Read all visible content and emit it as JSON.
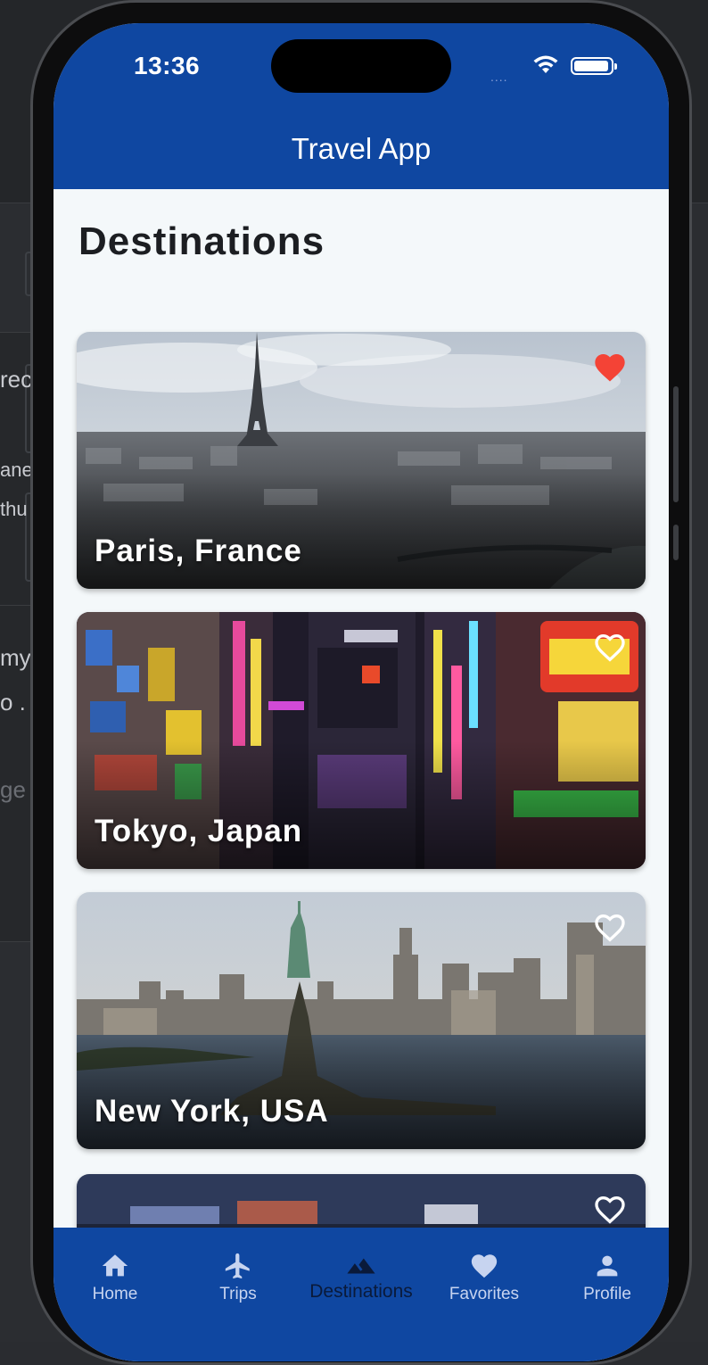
{
  "background": {
    "snippets": [
      "rec",
      "ane",
      "thu",
      "my",
      "o .",
      "ge"
    ]
  },
  "status_bar": {
    "time": "13:36",
    "signal": "....",
    "wifi_icon": "wifi-icon",
    "battery_icon": "battery-icon"
  },
  "app_bar": {
    "title": "Travel App",
    "color": "#0f47a1"
  },
  "page": {
    "heading": "Destinations"
  },
  "destinations": [
    {
      "name": "Paris, France",
      "favorite": true,
      "favorite_color": "#f44336"
    },
    {
      "name": "Tokyo, Japan",
      "favorite": false
    },
    {
      "name": "New York, USA",
      "favorite": false
    },
    {
      "name": "",
      "favorite": false
    }
  ],
  "bottom_nav": {
    "items": [
      {
        "label": "Home",
        "icon": "home-icon",
        "active": false
      },
      {
        "label": "Trips",
        "icon": "airplane-icon",
        "active": false
      },
      {
        "label": "Destinations",
        "icon": "terrain-icon",
        "active": true
      },
      {
        "label": "Favorites",
        "icon": "heart-icon",
        "active": false
      },
      {
        "label": "Profile",
        "icon": "person-icon",
        "active": false
      }
    ]
  }
}
